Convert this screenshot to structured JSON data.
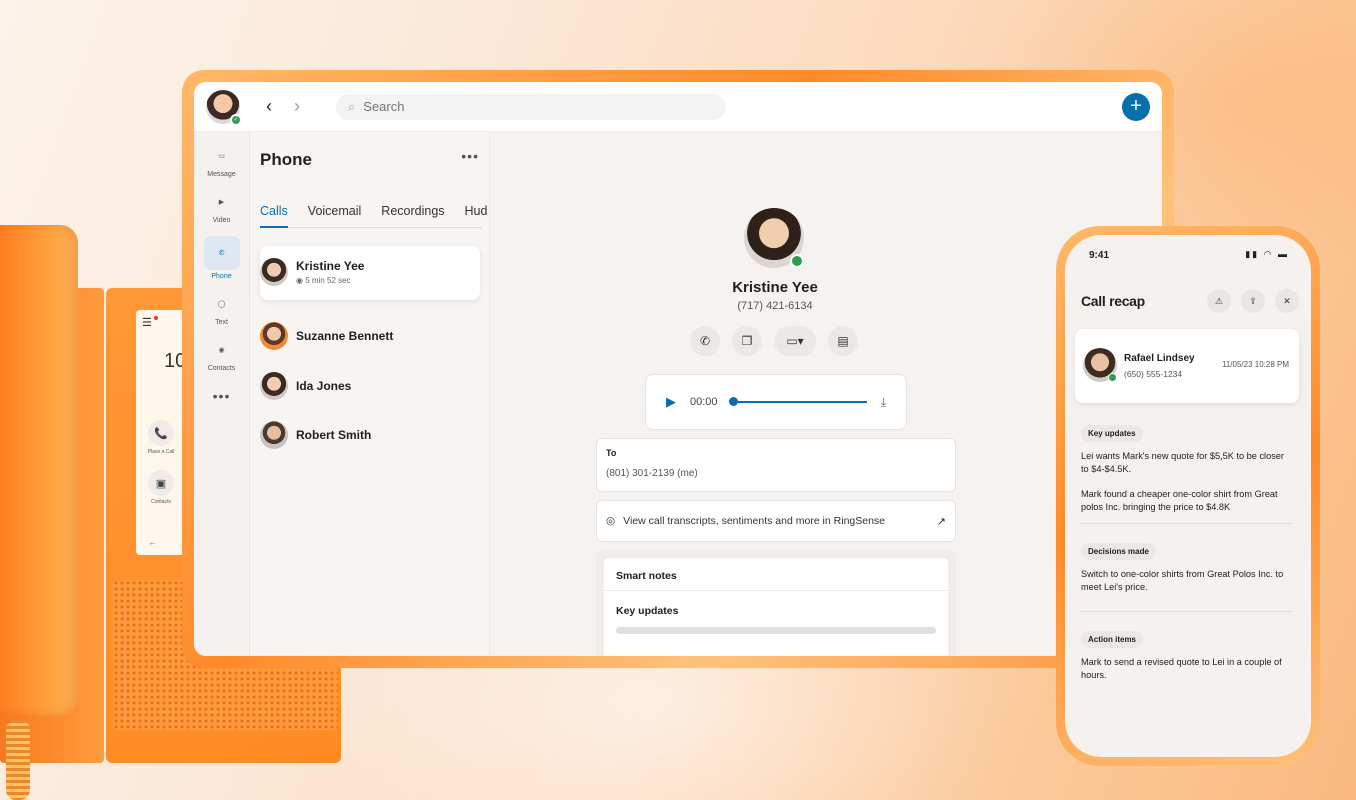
{
  "colors": {
    "accent": "#066fac",
    "online": "#2e9e4e",
    "brand_orange": "#ff8a22"
  },
  "desk_phone": {
    "screen_number": "10",
    "place_call_label": "Place a Call",
    "contacts_label": "Contacts"
  },
  "window": {
    "search_placeholder": "Search",
    "rail": [
      {
        "label": "Message",
        "icon": "message-icon"
      },
      {
        "label": "Video",
        "icon": "video-icon"
      },
      {
        "label": "Phone",
        "icon": "phone-icon"
      },
      {
        "label": "Text",
        "icon": "text-bubble-icon"
      },
      {
        "label": "Contacts",
        "icon": "contacts-icon"
      }
    ],
    "list": {
      "title": "Phone",
      "tabs": [
        "Calls",
        "Voicemail",
        "Recordings",
        "Hud"
      ],
      "active_tab": "Calls",
      "calls": [
        {
          "name": "Kristine Yee",
          "duration": "5 min 52 sec"
        },
        {
          "name": "Suzanne Bennett"
        },
        {
          "name": "Ida Jones"
        },
        {
          "name": "Robert Smith"
        }
      ]
    },
    "detail": {
      "name": "Kristine Yee",
      "number": "(717) 421-6134",
      "player_time": "00:00",
      "to_label": "To",
      "to_number": "(801) 301-2139 (me)",
      "ringsense_text": "View call transcripts, sentiments and more in RingSense",
      "smart_notes_title": "Smart notes",
      "key_updates_title": "Key updates"
    }
  },
  "mobile": {
    "time": "9:41",
    "title": "Call recap",
    "contact": {
      "name": "Rafael Lindsey",
      "number": "(650) 555-1234",
      "datetime": "11/05/23 10:28 PM"
    },
    "sections": [
      {
        "chip": "Key updates",
        "paragraphs": [
          "Lei wants Mark's new quote for $5,5K to be closer to $4-$4.5K.",
          "Mark found a cheaper one-color shirt from Great polos Inc. bringing the price to $4.8K"
        ]
      },
      {
        "chip": "Decisions made",
        "paragraphs": [
          "Switch to one-color shirts from Great Polos Inc. to meet Lei's price."
        ]
      },
      {
        "chip": "Action items",
        "paragraphs": [
          "Mark to send a revised quote to Lei in a couple of hours."
        ]
      }
    ]
  }
}
